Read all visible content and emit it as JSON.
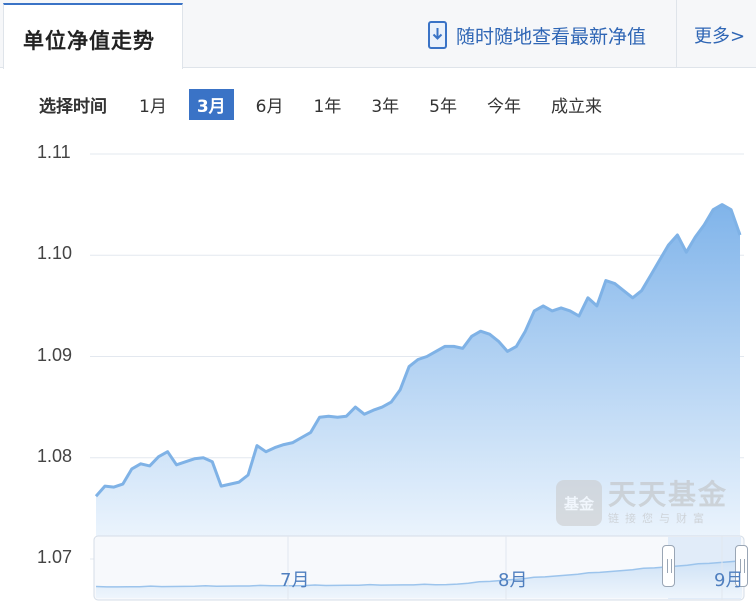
{
  "header": {
    "tab_title": "单位净值走势",
    "mobile_link": "随时随地查看最新净值",
    "more_link": "更多>"
  },
  "range": {
    "label": "选择时间",
    "options": [
      "1月",
      "3月",
      "6月",
      "1年",
      "3年",
      "5年",
      "今年",
      "成立来"
    ],
    "selected": "3月"
  },
  "watermark": {
    "logo_text": "基金",
    "name": "天天基金",
    "slogan": "链接您与财富"
  },
  "colors": {
    "accent": "#3a73c6",
    "line": "#7fb2e6",
    "fill_top": "#8bbcec",
    "fill_bottom": "#f1f7fd"
  },
  "chart_data": {
    "type": "area",
    "ylim": [
      1.07,
      1.11
    ],
    "yticks": [
      1.11,
      1.1,
      1.09,
      1.08,
      1.07
    ],
    "ytick_labels": [
      "1.11",
      "1.10",
      "1.09",
      "1.08",
      "1.07"
    ],
    "grid": true,
    "series": [
      {
        "values": [
          1.0762,
          1.0772,
          1.0771,
          1.0774,
          1.0789,
          1.0794,
          1.0792,
          1.0801,
          1.0806,
          1.0793,
          1.0796,
          1.0799,
          1.08,
          1.0796,
          1.0772,
          1.0774,
          1.0776,
          1.0783,
          1.0812,
          1.0806,
          1.081,
          1.0813,
          1.0815,
          1.082,
          1.0825,
          1.084,
          1.0841,
          1.084,
          1.0841,
          1.085,
          1.0843,
          1.0847,
          1.085,
          1.0855,
          1.0867,
          1.089,
          1.0897,
          1.09,
          1.0905,
          1.091,
          1.091,
          1.0908,
          1.092,
          1.0925,
          1.0922,
          1.0915,
          1.0905,
          1.091,
          1.0925,
          1.0945,
          1.095,
          1.0945,
          1.0948,
          1.0945,
          1.094,
          1.0958,
          1.095,
          1.0975,
          1.0972,
          1.0965,
          1.0958,
          1.0965,
          1.098,
          1.0995,
          1.101,
          1.102,
          1.1003,
          1.1018,
          1.103,
          1.1045,
          1.105,
          1.1045,
          1.102
        ]
      }
    ],
    "navigator": {
      "labels": [
        "7月",
        "8月",
        "9月"
      ]
    }
  }
}
